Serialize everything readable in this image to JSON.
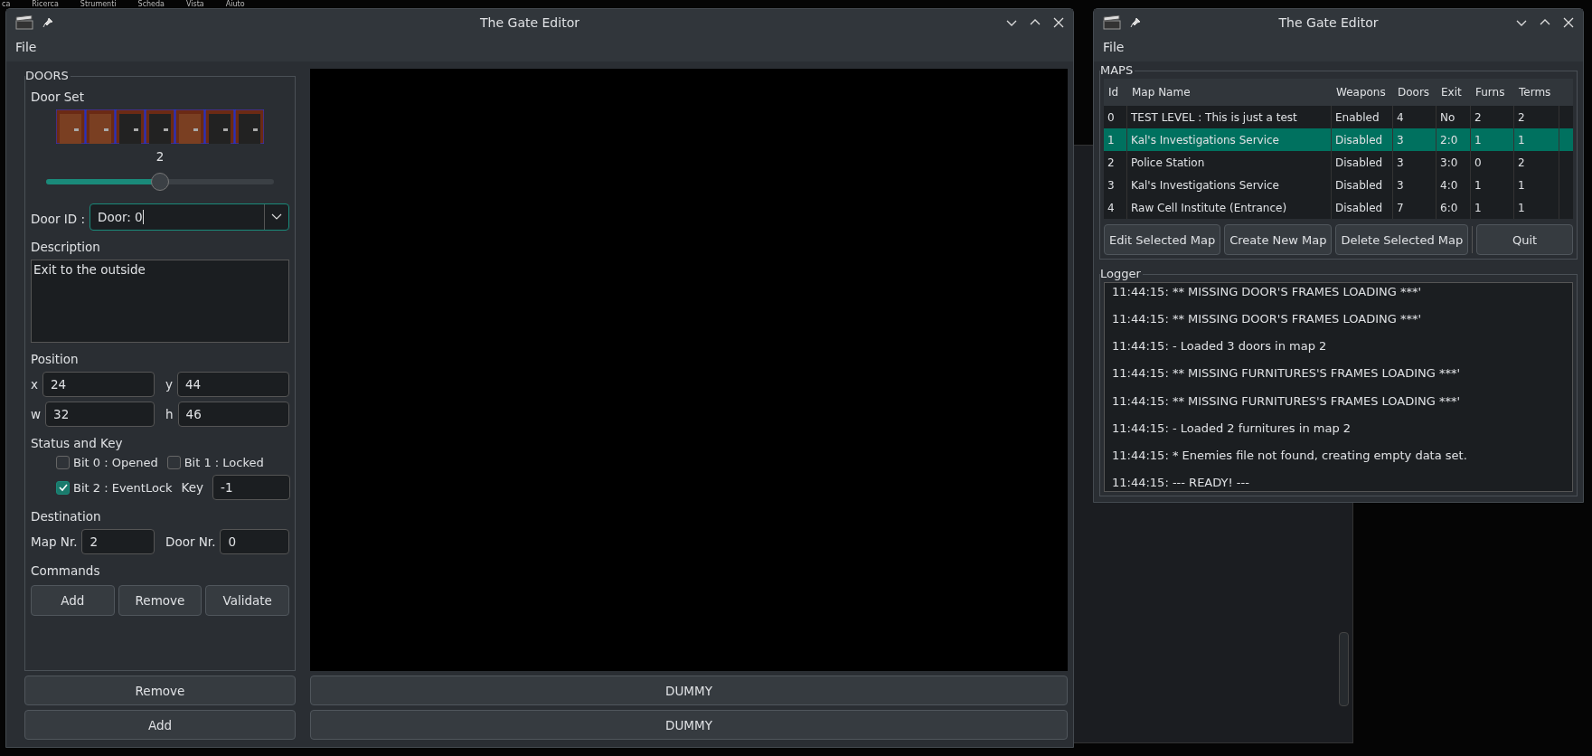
{
  "background_app": {
    "menu": [
      "ca",
      "Ricerca",
      "Strumenti",
      "Scheda",
      "Vista",
      "Aiuto"
    ]
  },
  "door_window": {
    "title": "The Gate Editor",
    "menu": [
      "File"
    ],
    "doors": {
      "title": "DOORS",
      "door_set_label": "Door Set",
      "door_set_value": "2",
      "door_set_slider": {
        "level": 0.5
      },
      "door_id": {
        "label": "Door ID :",
        "value": "Door: 0"
      },
      "description": {
        "label": "Description",
        "value": "Exit to the outside"
      },
      "position": {
        "label": "Position",
        "fields": [
          {
            "label": "x",
            "value": "24"
          },
          {
            "label": "y",
            "value": "44"
          },
          {
            "label": "w",
            "value": "32"
          },
          {
            "label": "h",
            "value": "46"
          }
        ]
      },
      "status": {
        "label": "Status and Key",
        "bits": [
          {
            "label": "Bit 0 : Opened",
            "checked": false
          },
          {
            "label": "Bit 1 : Locked",
            "checked": false
          },
          {
            "label": "Bit 2 : EventLock",
            "checked": true
          }
        ],
        "key_label": "Key",
        "key_value": "-1"
      },
      "destination": {
        "label": "Destination",
        "fields": [
          {
            "label": "Map Nr.",
            "value": "2"
          },
          {
            "label": "Door Nr.",
            "value": "0"
          }
        ]
      },
      "commands": {
        "label": "Commands",
        "buttons": [
          "Add",
          "Remove",
          "Validate"
        ]
      }
    },
    "left_buttons": [
      "Remove",
      "Add"
    ],
    "right_buttons": [
      "DUMMY",
      "DUMMY"
    ]
  },
  "maps_window": {
    "title": "The Gate Editor",
    "menu": [
      "File"
    ],
    "maps": {
      "title": "MAPS",
      "columns": [
        "Id",
        "Map Name",
        "Weapons",
        "Doors",
        "Exit",
        "Furns",
        "Terms"
      ],
      "rows": [
        {
          "cells": [
            "0",
            "TEST LEVEL : This is just a test",
            "Enabled",
            "4",
            "No",
            "2",
            "2"
          ],
          "selected": false
        },
        {
          "cells": [
            "1",
            "Kal's Investigations Service",
            "Disabled",
            "3",
            "2:0",
            "1",
            "1"
          ],
          "selected": true
        },
        {
          "cells": [
            "2",
            "Police Station",
            "Disabled",
            "3",
            "3:0",
            "0",
            "2"
          ],
          "selected": false
        },
        {
          "cells": [
            "3",
            "Kal's Investigations Service",
            "Disabled",
            "3",
            "4:0",
            "1",
            "1"
          ],
          "selected": false
        },
        {
          "cells": [
            "4",
            "Raw Cell Institute (Entrance)",
            "Disabled",
            "7",
            "6:0",
            "1",
            "1"
          ],
          "selected": false
        }
      ],
      "buttons": [
        "Edit Selected Map",
        "Create New Map",
        "Delete Selected Map"
      ],
      "quit": "Quit"
    },
    "logger": {
      "title": "Logger",
      "lines": [
        "11:44:15: ** MISSING DOOR'S FRAMES LOADING ***'",
        "11:44:15: ** MISSING DOOR'S FRAMES LOADING ***'",
        "11:44:15: - Loaded 3 doors in map 2",
        "11:44:15: ** MISSING FURNITURES'S FRAMES LOADING ***'",
        "11:44:15: ** MISSING FURNITURES'S FRAMES LOADING ***'",
        "11:44:15: - Loaded 2 furnitures in map 2",
        "11:44:15: * Enemies file not found, creating empty data set.",
        "11:44:15: --- READY! ---"
      ]
    }
  }
}
